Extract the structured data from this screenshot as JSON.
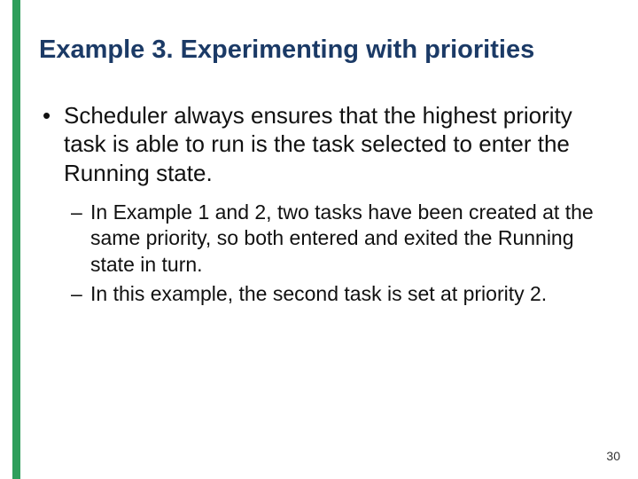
{
  "title": "Example 3. Experimenting with priorities",
  "bullets": {
    "main": "Scheduler always ensures that the highest priority task is able to run is the task selected to enter the Running state.",
    "sub1": "In Example 1 and 2, two tasks have been created at the same priority, so both entered and exited the Running state in turn.",
    "sub2": "In this example, the second task is set at priority 2."
  },
  "pageNumber": "30"
}
